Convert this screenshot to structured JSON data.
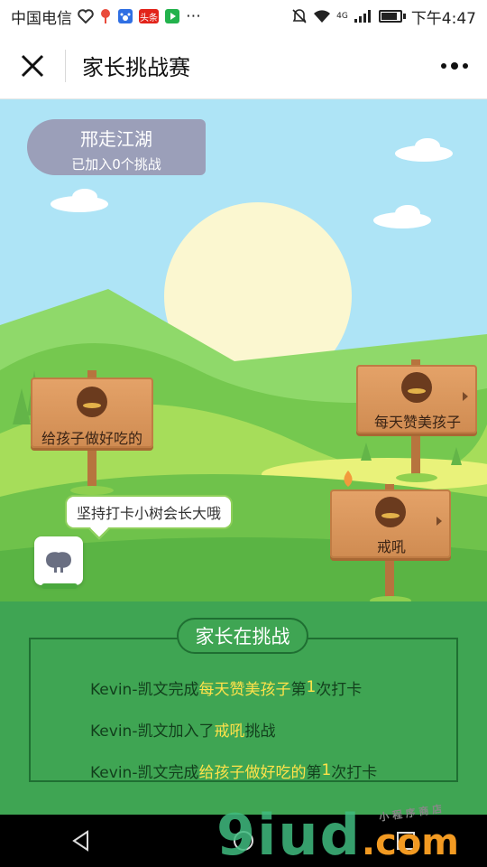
{
  "status_bar": {
    "carrier": "中国电信",
    "badge_label": "头条",
    "signal_label": "4G",
    "time": "下午4:47"
  },
  "title_bar": {
    "title": "家长挑战赛",
    "close_icon": "close-icon",
    "more_icon": "more-icon"
  },
  "user": {
    "name": "邢走江湖",
    "joined": "已加入0个挑战"
  },
  "signs": [
    {
      "label": "给孩子做好吃的"
    },
    {
      "label": "每天赞美孩子"
    },
    {
      "label": "戒吼"
    }
  ],
  "tip": "坚持打卡小树会长大哦",
  "panel": {
    "title": "家长在挑战",
    "feed": [
      {
        "pre": "Kevin-凯文完成",
        "hl": "每天赞美孩子",
        "mid": "第",
        "num": "1",
        "post": "次打卡"
      },
      {
        "pre": "Kevin-凯文加入了",
        "hl": "戒吼",
        "mid": "",
        "num": "",
        "post": "挑战"
      },
      {
        "pre": "Kevin-凯文完成",
        "hl": "给孩子做好吃的",
        "mid": "第",
        "num": "1",
        "post": "次打卡"
      }
    ]
  },
  "watermark": {
    "main": "9iud",
    "suffix": ".com",
    "small": "小 程 序 商 店"
  },
  "colors": {
    "sky": "#aee4f6",
    "panel_green": "#3fa553",
    "highlight": "#ffe24a",
    "pill": "#9b9fb9"
  }
}
